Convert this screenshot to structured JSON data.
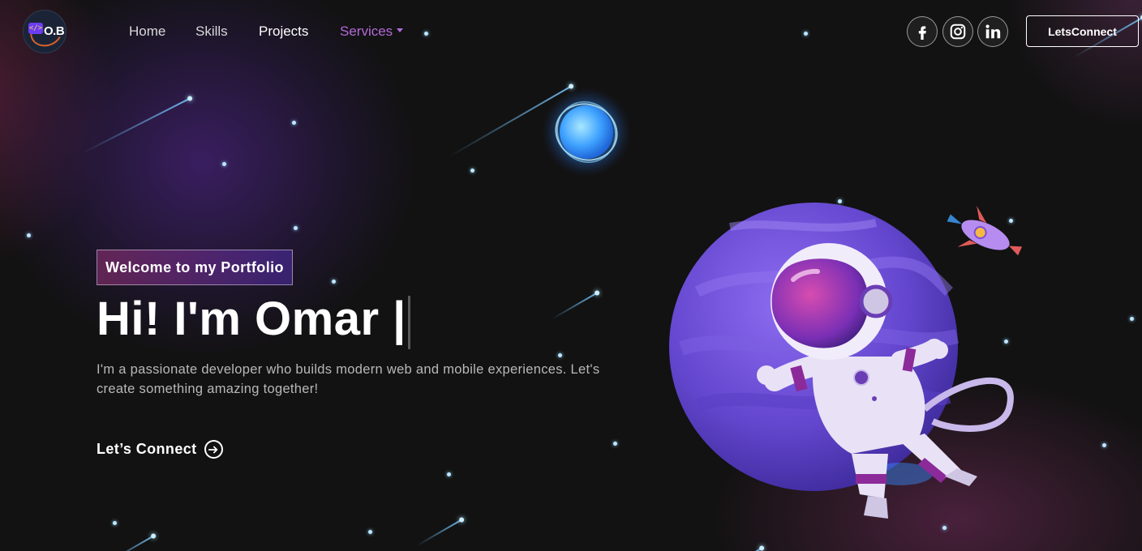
{
  "brand": {
    "logo_text": "O.B",
    "logo_mark": "</>"
  },
  "nav": {
    "links": [
      "Home",
      "Skills",
      "Projects",
      "Services"
    ],
    "social": [
      "facebook-icon",
      "instagram-icon",
      "linkedin-icon"
    ],
    "connect_label": "LetsConnect"
  },
  "hero": {
    "tagline": "Welcome to my Portfolio",
    "headline": "Hi! I'm Omar |",
    "description": "I'm a passionate developer who builds modern web and mobile experiences. Let's create something amazing together!",
    "cta_label": "Let’s Connect",
    "cta_icon": "arrow-right-circle-icon"
  },
  "colors": {
    "background": "#121212",
    "services_accent": "#b36ad8",
    "planet": "#6a4bd6",
    "tagline_gradient": [
      "#aa367c",
      "#4a2fbd"
    ]
  }
}
